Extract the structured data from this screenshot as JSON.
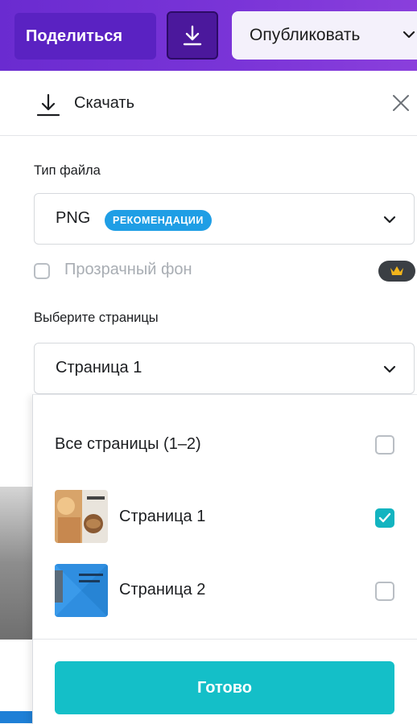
{
  "toolbar": {
    "share_label": "Поделиться",
    "download_icon": "download-icon",
    "publish_label": "Опубликовать"
  },
  "panel": {
    "title": "Скачать",
    "file_type_label": "Тип файла",
    "file_type_value": "PNG",
    "file_type_badge": "РЕКОМЕНДАЦИИ",
    "transparent_label": "Прозрачный фон",
    "transparent_checked": false,
    "pages_label": "Выберите страницы",
    "pages_value": "Страница 1"
  },
  "dropdown": {
    "all_pages_label": "Все страницы (1–2)",
    "items": [
      {
        "label": "Страница 1",
        "checked": true
      },
      {
        "label": "Страница 2",
        "checked": false
      }
    ],
    "done_label": "Готово"
  },
  "colors": {
    "accent": "#14bfc8",
    "toolbar": "#7b35d8",
    "badge": "#1f9ee5"
  }
}
